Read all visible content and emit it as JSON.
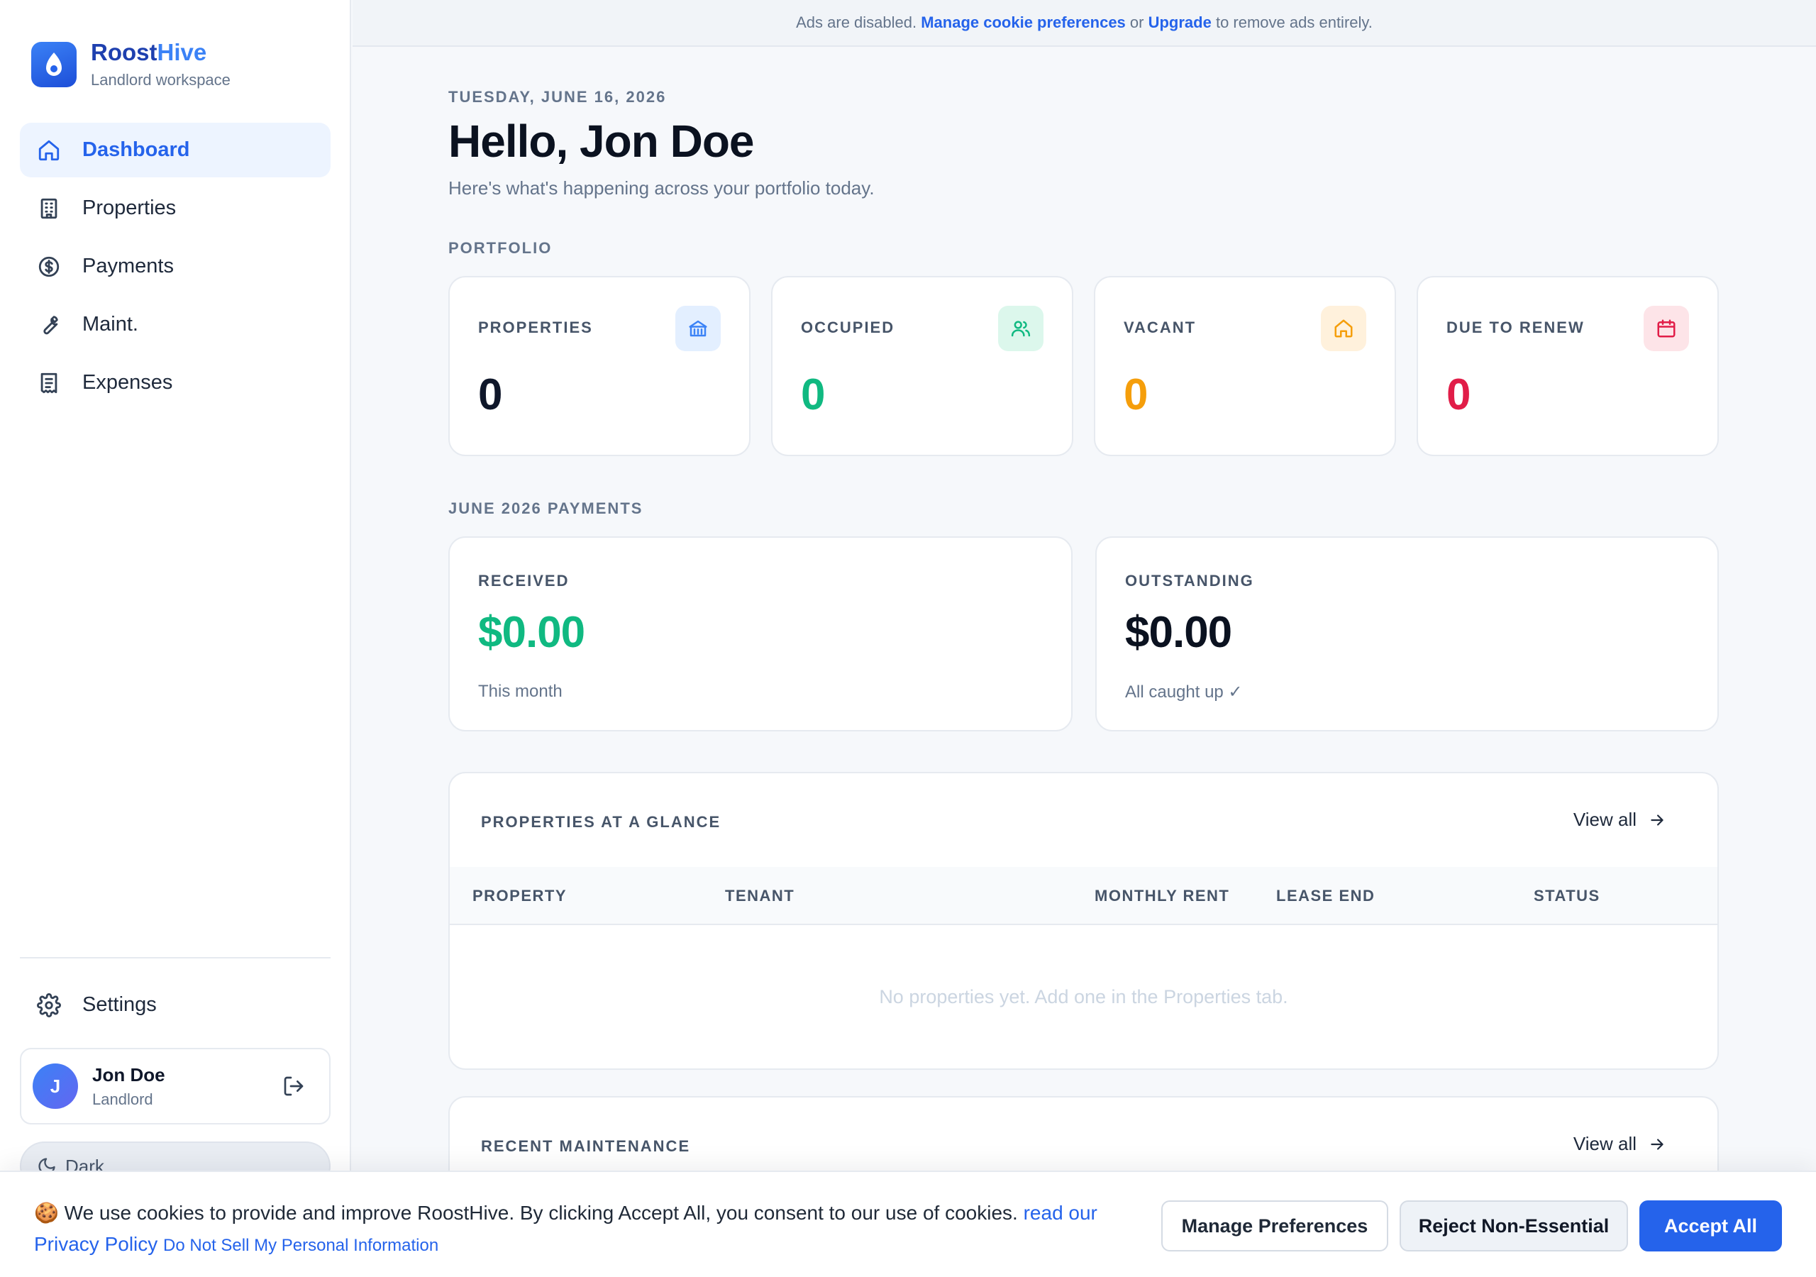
{
  "brand": {
    "name_part1": "Roost",
    "name_part2": "Hive",
    "subtitle": "Landlord workspace"
  },
  "sidebar": {
    "items": [
      {
        "label": "Dashboard",
        "icon": "home-icon",
        "active": true
      },
      {
        "label": "Properties",
        "icon": "building-icon"
      },
      {
        "label": "Payments",
        "icon": "dollar-circle-icon"
      },
      {
        "label": "Maint.",
        "icon": "wrench-icon"
      },
      {
        "label": "Expenses",
        "icon": "receipt-icon"
      }
    ],
    "settings_label": "Settings",
    "theme_label": "Dark"
  },
  "user": {
    "initial": "J",
    "name": "Jon Doe",
    "role": "Landlord"
  },
  "ad_banner": {
    "text_before": "Ads are disabled. ",
    "link_manage": "Manage cookie preferences",
    "text_or": " or ",
    "link_upgrade": "Upgrade",
    "text_after": " to remove ads entirely."
  },
  "header": {
    "date": "TUESDAY, JUNE 16, 2026",
    "greeting": "Hello, Jon Doe",
    "subtitle": "Here's what's happening across your portfolio today."
  },
  "portfolio": {
    "section_label": "PORTFOLIO",
    "stats": [
      {
        "label": "PROPERTIES",
        "value": "0",
        "color": "#0f172a",
        "icon": "bank-icon",
        "icon_bg": "#e3efff",
        "icon_color": "#3b82f6"
      },
      {
        "label": "OCCUPIED",
        "value": "0",
        "color": "#10b981",
        "icon": "users-icon",
        "icon_bg": "#dcf7ec",
        "icon_color": "#10b981"
      },
      {
        "label": "VACANT",
        "value": "0",
        "color": "#f59e0b",
        "icon": "house-icon",
        "icon_bg": "#fff1dc",
        "icon_color": "#f59e0b"
      },
      {
        "label": "DUE TO RENEW",
        "value": "0",
        "color": "#e11d48",
        "icon": "calendar-icon",
        "icon_bg": "#fde4e8",
        "icon_color": "#e11d48"
      }
    ]
  },
  "payments": {
    "section_label": "JUNE 2026 PAYMENTS",
    "received": {
      "label": "RECEIVED",
      "value": "$0.00",
      "note": "This month",
      "color": "#10b981"
    },
    "outstanding": {
      "label": "OUTSTANDING",
      "value": "$0.00",
      "note": "All caught up ✓",
      "color": "#0b1220"
    }
  },
  "properties_panel": {
    "title": "PROPERTIES AT A GLANCE",
    "view_all": "View all",
    "columns": [
      "PROPERTY",
      "TENANT",
      "MONTHLY RENT",
      "LEASE END",
      "STATUS"
    ],
    "empty_message": "No properties yet. Add one in the Properties tab."
  },
  "maintenance_panel": {
    "title": "RECENT MAINTENANCE",
    "view_all": "View all"
  },
  "cookie": {
    "message": "🍪 We use cookies to provide and improve RoostHive. By clicking Accept All, you consent to our use of cookies. ",
    "link_read": "read our Privacy Policy",
    "link_dns": "Do Not Sell My Personal Information",
    "btn_manage": "Manage Preferences",
    "btn_reject": "Reject Non-Essential",
    "btn_accept": "Accept All"
  }
}
